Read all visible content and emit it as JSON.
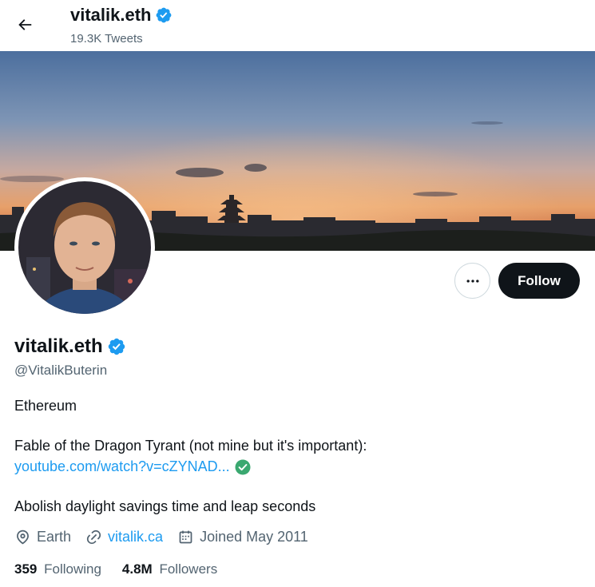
{
  "header": {
    "name": "vitalik.eth",
    "tweets_count": "19.3K Tweets",
    "back_icon": "arrow-left-icon"
  },
  "banner": {
    "description_icon": "banner-image",
    "sky_top": "#4a6e9e",
    "sky_glow": "#e9a46a"
  },
  "avatar": {
    "icon": "avatar-photo"
  },
  "actions": {
    "more_icon": "more-horizontal-icon",
    "follow_label": "Follow"
  },
  "profile": {
    "name": "vitalik.eth",
    "handle": "@VitalikButerin",
    "verified_color": "#1d9bf0",
    "bio": {
      "line1": "Ethereum",
      "line2": "Fable of the Dragon Tyrant (not mine but it's important):",
      "link": "youtube.com/watch?v=cZYNAD...",
      "link_check_color": "#3aa870",
      "line3": "Abolish daylight savings time and leap seconds"
    },
    "location": "Earth",
    "website": "vitalik.ca",
    "joined": "Joined May 2011",
    "following_count": "359",
    "following_label": "Following",
    "followers_count": "4.8M",
    "followers_label": "Followers"
  },
  "colors": {
    "text_primary": "#0f1419",
    "text_secondary": "#536471",
    "link": "#1d9bf0",
    "follow_bg": "#0f1419"
  }
}
